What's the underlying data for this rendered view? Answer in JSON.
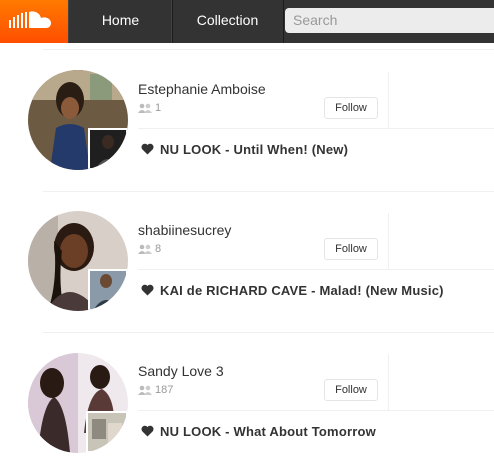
{
  "nav": {
    "home_label": "Home",
    "collection_label": "Collection",
    "search_placeholder": "Search"
  },
  "items": [
    {
      "user": "Estephanie Amboise",
      "followers": "1",
      "follow_label": "Follow",
      "track": "NU LOOK - Until When! (New)"
    },
    {
      "user": "shabiinesucrey",
      "followers": "8",
      "follow_label": "Follow",
      "track": "KAI de RICHARD CAVE - Malad! (New Music)"
    },
    {
      "user": "Sandy Love 3",
      "followers": "187",
      "follow_label": "Follow",
      "track": "NU LOOK - What About Tomorrow"
    }
  ],
  "colors": {
    "brand": "#ff5500",
    "topbar": "#333333"
  }
}
